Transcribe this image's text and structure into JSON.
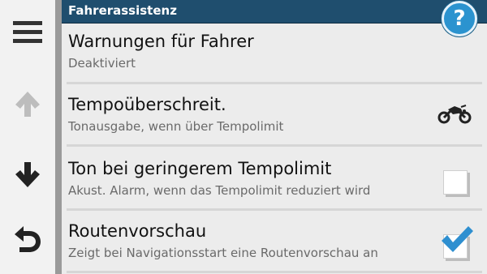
{
  "header": {
    "title": "Fahrerassistenz",
    "help_label": "?"
  },
  "sidebar": {
    "items": [
      {
        "name": "menu",
        "icon": "hamburger-menu-icon"
      },
      {
        "name": "scroll-up",
        "icon": "arrow-up-icon"
      },
      {
        "name": "scroll-down",
        "icon": "arrow-down-icon"
      },
      {
        "name": "back",
        "icon": "back-arrow-icon"
      }
    ]
  },
  "settings": [
    {
      "title": "Warnungen für Fahrer",
      "subtitle": "Deaktiviert",
      "control": "none"
    },
    {
      "title": "Tempoüberschreit.",
      "subtitle": "Tonausgabe, wenn über Tempolimit",
      "control": "motorcycle-icon"
    },
    {
      "title": "Ton bei geringerem Tempolimit",
      "subtitle": "Akust. Alarm, wenn das Tempolimit reduziert wird",
      "control": "checkbox",
      "checked": false
    },
    {
      "title": "Routenvorschau",
      "subtitle": "Zeigt bei Navigationsstart eine Routenvorschau an",
      "control": "checkbox",
      "checked": true
    }
  ],
  "colors": {
    "header": "#1f4e6e",
    "help": "#2b93cf",
    "check": "#2e8fd0"
  }
}
